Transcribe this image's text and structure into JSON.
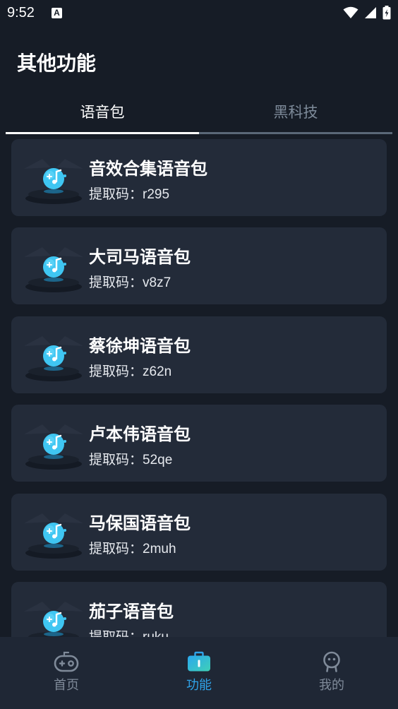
{
  "status_bar": {
    "time": "9:52",
    "notification_letter": "A"
  },
  "header": {
    "title": "其他功能"
  },
  "tabs": [
    {
      "label": "语音包",
      "active": true
    },
    {
      "label": "黑科技",
      "active": false
    }
  ],
  "code_prefix": "提取码：",
  "voice_packs": [
    {
      "title": "音效合集语音包",
      "code": "r295"
    },
    {
      "title": "大司马语音包",
      "code": "v8z7"
    },
    {
      "title": "蔡徐坤语音包",
      "code": "z62n"
    },
    {
      "title": "卢本伟语音包",
      "code": "52qe"
    },
    {
      "title": "马保国语音包",
      "code": "2muh"
    },
    {
      "title": "茄子语音包",
      "code": "ruku"
    }
  ],
  "bottom_nav": [
    {
      "label": "首页",
      "icon": "gamepad-icon",
      "active": false
    },
    {
      "label": "功能",
      "icon": "toolbox-icon",
      "active": true
    },
    {
      "label": "我的",
      "icon": "profile-icon",
      "active": false
    }
  ],
  "colors": {
    "background": "#161c26",
    "card": "#232b39",
    "accent": "#2fa4ea",
    "inactive": "#7f8a99"
  }
}
